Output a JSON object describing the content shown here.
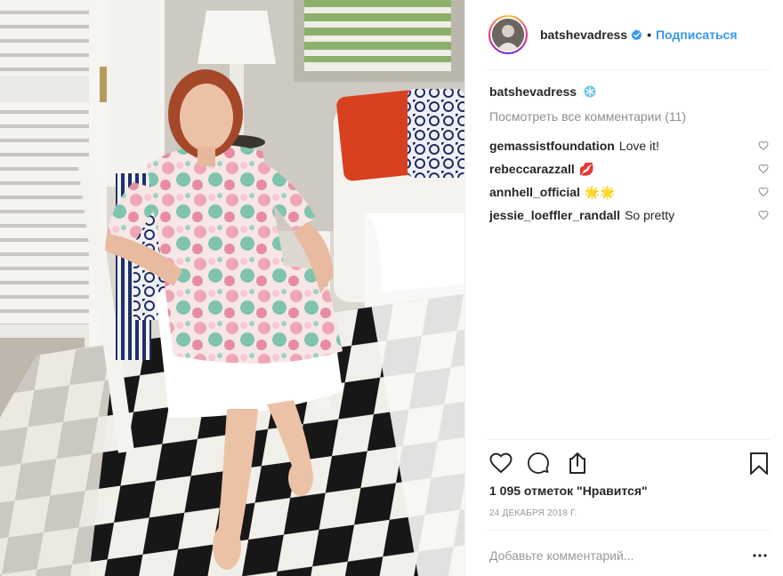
{
  "header": {
    "username": "batshevadress",
    "separator": "•",
    "follow_label": "Подписаться"
  },
  "caption": {
    "username": "batshevadress",
    "icon": "snowflake-emoji"
  },
  "view_all_comments": "Посмотреть все комментарии (11)",
  "comments": [
    {
      "user": "gemassistfoundation",
      "text": "Love it!"
    },
    {
      "user": "rebeccarazzall",
      "text": "💋"
    },
    {
      "user": "annhell_official",
      "text": "🌟🌟"
    },
    {
      "user": "jessie_loeffler_randall",
      "text": "So pretty"
    }
  ],
  "likes": "1 095 отметок \"Нравится\"",
  "date": "24 ДЕКАБРЯ 2018 Г.",
  "add_comment_placeholder": "Добавьте комментарий...",
  "icons": {
    "like": "heart-icon",
    "comment": "comment-icon",
    "share": "share-icon",
    "save": "bookmark-icon",
    "more": "more-dots-icon",
    "verified": "verified-badge-icon"
  },
  "colors": {
    "link_blue": "#3897f0",
    "verified_blue": "#3897f0",
    "muted_text": "#8e8e8e",
    "divider": "#efefef"
  }
}
